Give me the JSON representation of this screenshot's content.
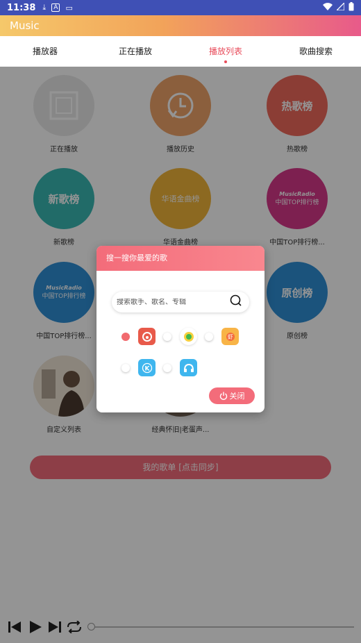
{
  "status_bar": {
    "time": "11:38"
  },
  "app": {
    "title": "Music"
  },
  "tabs": [
    {
      "label": "播放器"
    },
    {
      "label": "正在播放"
    },
    {
      "label": "播放列表"
    },
    {
      "label": "歌曲搜索"
    }
  ],
  "grid": [
    {
      "caption": "正在播放",
      "art": ""
    },
    {
      "caption": "播放历史",
      "art": ""
    },
    {
      "caption": "热歌榜",
      "art": "热歌榜"
    },
    {
      "caption": "新歌榜",
      "art": "新歌榜"
    },
    {
      "caption": "华语金曲榜",
      "art": "华语金曲榜"
    },
    {
      "caption": "中国TOP排行榜...",
      "art_top": "MusicRadio",
      "art_bottom": "中国TOP排行榜"
    },
    {
      "caption": "中国TOP排行榜...",
      "art_top": "MusicRadio",
      "art_bottom": "中国TOP排行榜"
    },
    {
      "caption": "",
      "art": ""
    },
    {
      "caption": "原创榜",
      "art": "原创榜"
    },
    {
      "caption": "自定义列表",
      "art": ""
    },
    {
      "caption": "经典怀旧|老蛋声...",
      "art": ""
    }
  ],
  "sync_button": {
    "label": "我的歌单 [点击同步]"
  },
  "dialog": {
    "title": "搜一搜你最爱的歌",
    "search_placeholder": "搜索歌手、歌名、专辑",
    "close_label": "关闭",
    "sources": [
      {
        "icon": "netease-music-icon",
        "color": "#e85a4a",
        "selected": true
      },
      {
        "icon": "qq-music-icon",
        "color": "#ffffff",
        "selected": false
      },
      {
        "icon": "xiami-music-icon",
        "color": "#f8b447",
        "selected": false
      },
      {
        "icon": "kugou-music-icon",
        "color": "#3fb6ee",
        "selected": false
      },
      {
        "icon": "kuwo-music-icon",
        "color": "#3fb6ee",
        "selected": false
      }
    ]
  },
  "colors": {
    "accent": "#f36c7a",
    "status_bar": "#3f50b5"
  }
}
